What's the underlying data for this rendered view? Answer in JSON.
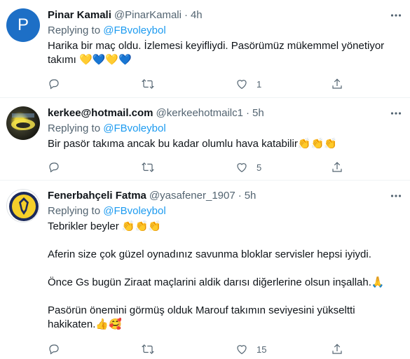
{
  "tweets": [
    {
      "avatar_letter": "P",
      "name": "Pinar Kamali",
      "handle": "@PinarKamali",
      "time": "4h",
      "replying_prefix": "Replying to ",
      "replying_to": "@FBvoleybol",
      "text": "Harika bir maç oldu. İzlemesi keyifliydi. Pasörümüz mükemmel yönetiyor takımı 💛💙💛💙",
      "reply_count": "",
      "retweet_count": "",
      "like_count": "1"
    },
    {
      "avatar_letter": "",
      "name": "kerkee@hotmail.com",
      "handle": "@kerkeehotmailc1",
      "time": "5h",
      "replying_prefix": "Replying to ",
      "replying_to": "@FBvoleybol",
      "text": "Bir pasör takıma ancak bu kadar olumlu hava katabilir👏👏👏",
      "reply_count": "",
      "retweet_count": "",
      "like_count": "5"
    },
    {
      "avatar_letter": "",
      "name": "Fenerbahçeli Fatma",
      "handle": "@yasafener_1907",
      "time": "5h",
      "replying_prefix": "Replying to ",
      "replying_to": "@FBvoleybol",
      "text": "Tebrikler beyler 👏👏👏\n\nAferin size çok güzel oynadınız savunma bloklar servisler hepsi iyiydi.\n\nÖnce Gs bugün Ziraat maçlarini aldik darısı diğerlerine olsun inşallah.🙏\n\nPasörün önemini görmüş olduk Marouf takımın seviyesini yükseltti hakikaten.👍🥰",
      "reply_count": "",
      "retweet_count": "",
      "like_count": "15"
    }
  ],
  "colors": {
    "link": "#1d9bf0",
    "secondary": "#536471",
    "divider": "#eff3f4"
  }
}
